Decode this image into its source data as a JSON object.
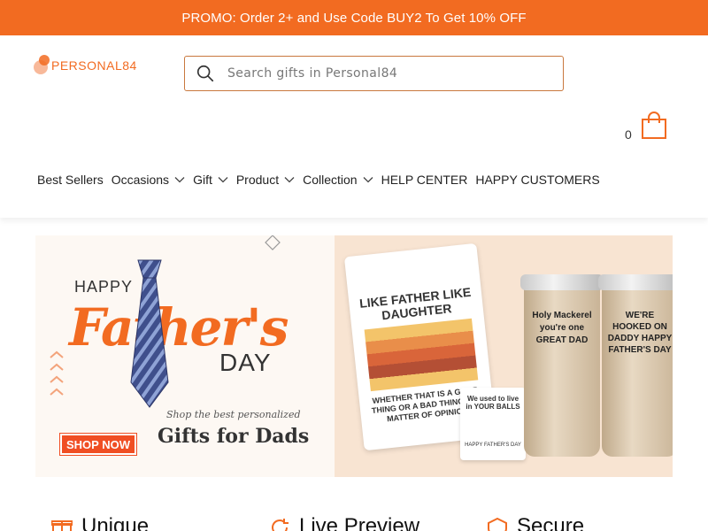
{
  "promo": {
    "text": "PROMO: Order 2+ and Use Code BUY2 To Get 10% OFF"
  },
  "brand": {
    "name": "PERSONAL84",
    "accent": "#f26b21"
  },
  "search": {
    "placeholder": "Search gifts in Personal84",
    "icon": "search-icon"
  },
  "cart": {
    "count": "0",
    "icon": "shopping-bag-icon"
  },
  "nav": {
    "items": [
      {
        "label": "Best Sellers",
        "dropdown": false
      },
      {
        "label": "Occasions",
        "dropdown": true
      },
      {
        "label": "Gift",
        "dropdown": true
      },
      {
        "label": "Product",
        "dropdown": true
      },
      {
        "label": "Collection",
        "dropdown": true
      },
      {
        "label": "HELP CENTER",
        "dropdown": false
      },
      {
        "label": "HAPPY CUSTOMERS",
        "dropdown": false
      }
    ]
  },
  "hero": {
    "happy": "HAPPY",
    "fathers": "Father's",
    "day": "DAY",
    "tagline": "Shop the best personalized",
    "gifts": "Gifts for Dads",
    "shop_button": "SHOP NOW",
    "tshirt_top": "LIKE FATHER LIKE DAUGHTER",
    "tshirt_bottom": "WHETHER THAT IS A GOOD THING OR A BAD THING IS A MATTER OF OPINION",
    "mug_top": "We used to live in YOUR BALLS",
    "mug_bottom": "HAPPY FATHER'S DAY",
    "tumbler1": "Holy Mackerel you're one GREAT DAD",
    "tumbler2": "WE'RE HOOKED ON DADDY HAPPY FATHER'S DAY"
  },
  "features": [
    {
      "label": "Unique",
      "icon": "gift-box-icon"
    },
    {
      "label": "Live Preview",
      "icon": "refresh-icon"
    },
    {
      "label": "Secure",
      "icon": "shield-icon"
    }
  ]
}
